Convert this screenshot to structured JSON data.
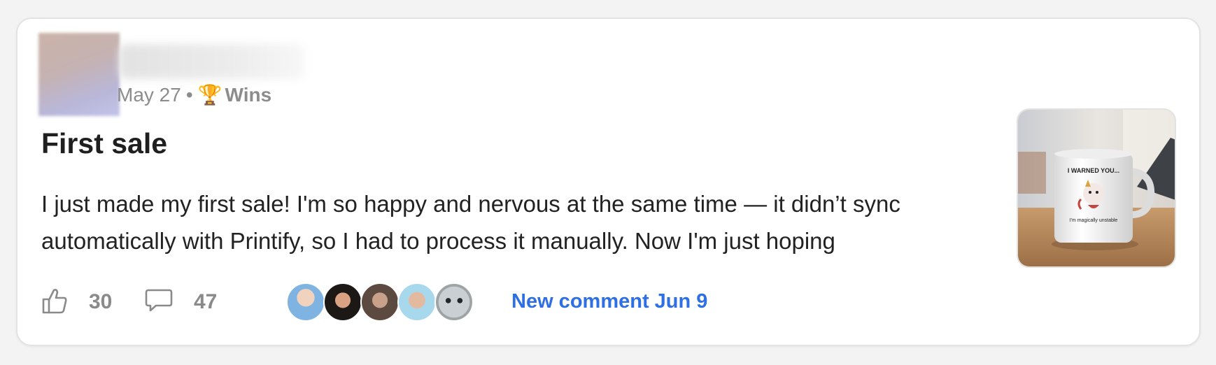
{
  "post": {
    "date": "May 27",
    "separator": "•",
    "category_icon": "trophy-icon",
    "category": "Wins",
    "title": "First sale",
    "excerpt": "I just made my first sale! I'm so happy and nervous at the same time — it didn’t sync automatically with Printify, so I had to process it manually. Now I'm just hoping",
    "thumbnail_text_top": "I WARNED YOU...",
    "thumbnail_text_bottom": "I'm magically unstable"
  },
  "stats": {
    "like_icon": "thumbs-up-icon",
    "likes": "30",
    "comment_icon": "comment-icon",
    "comments": "47"
  },
  "commenters": [
    {
      "name": "commenter-avatar-1",
      "color": "#6aa4d6"
    },
    {
      "name": "commenter-avatar-2",
      "color": "#2a2520"
    },
    {
      "name": "commenter-avatar-3",
      "color": "#8b7060"
    },
    {
      "name": "commenter-avatar-4",
      "color": "#8cc6e0"
    },
    {
      "name": "commenter-avatar-5",
      "color": "#9aa0a2"
    }
  ],
  "new_comment": "New comment Jun 9",
  "colors": {
    "link": "#2f6fe4",
    "muted": "#8c8c8c",
    "text": "#222222"
  }
}
